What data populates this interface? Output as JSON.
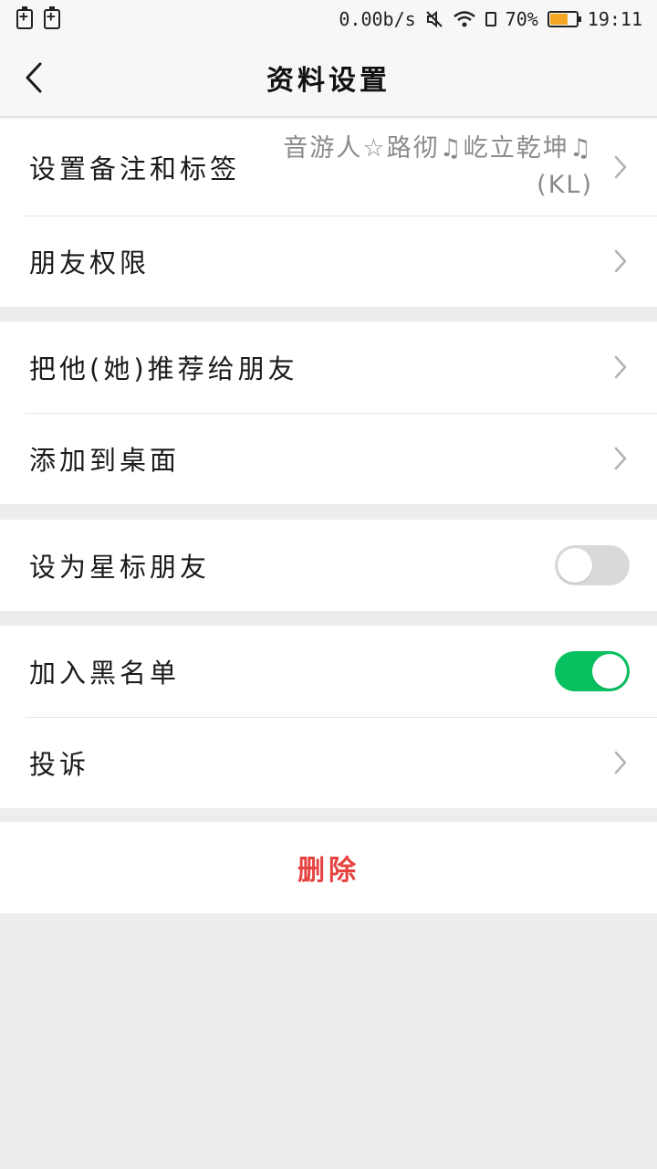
{
  "status_bar": {
    "speed": "0.00b/s",
    "battery_pct": "70%",
    "battery_level": 0.7,
    "time": "19:11"
  },
  "nav": {
    "title": "资料设置"
  },
  "group1": {
    "remark": {
      "label": "设置备注和标签",
      "value": "音游人☆路彻♫屹立乾坤♫ (KL)"
    },
    "permissions": {
      "label": "朋友权限"
    }
  },
  "group2": {
    "recommend": {
      "label": "把他(她)推荐给朋友"
    },
    "desktop": {
      "label": "添加到桌面"
    }
  },
  "group3": {
    "star": {
      "label": "设为星标朋友",
      "enabled": false
    }
  },
  "group4": {
    "blacklist": {
      "label": "加入黑名单",
      "enabled": true
    },
    "complain": {
      "label": "投诉"
    }
  },
  "delete": {
    "label": "删除"
  },
  "colors": {
    "accent_green": "#07c160",
    "danger_red": "#e64340",
    "battery_orange": "#f5a623"
  }
}
